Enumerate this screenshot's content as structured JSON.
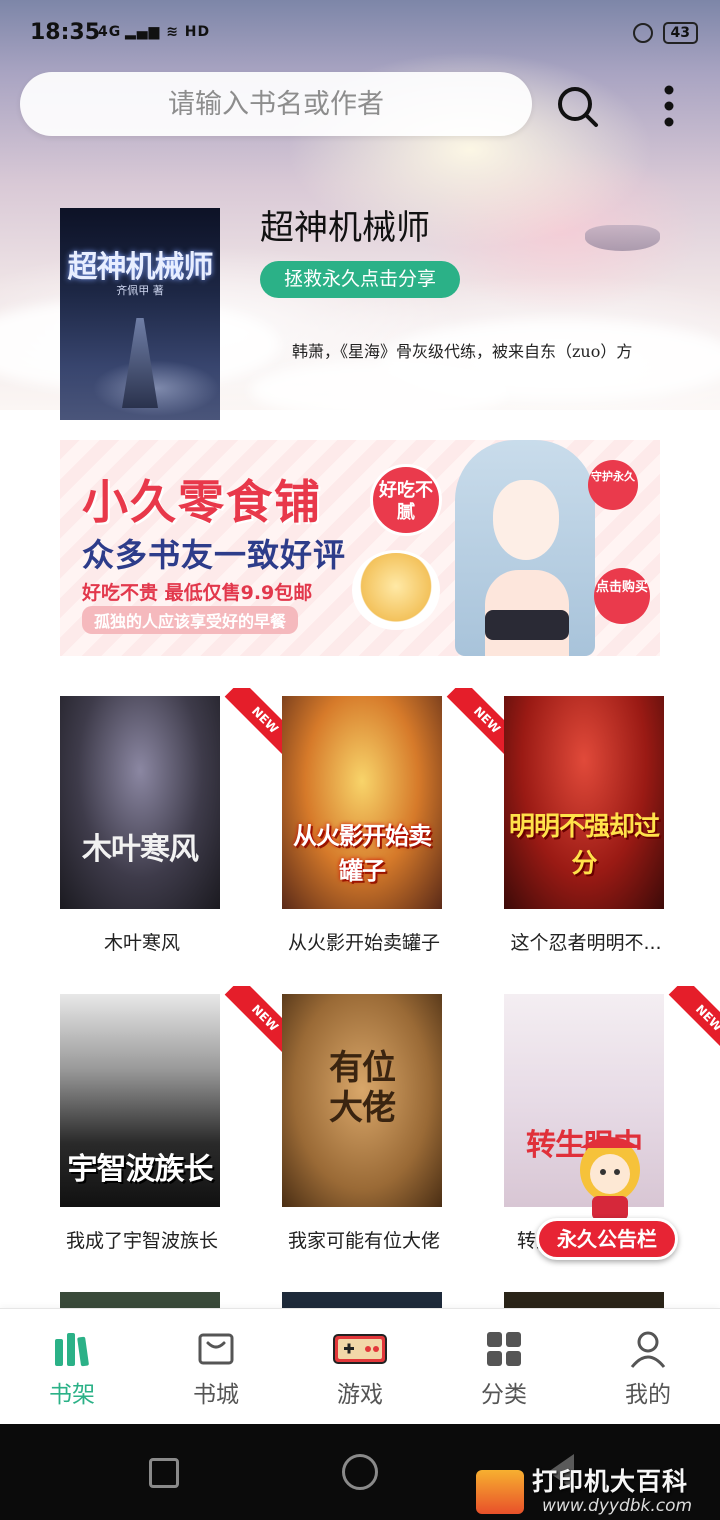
{
  "status_bar": {
    "time": "18:35",
    "indicators": "4G ▂▄▆ ≋ HD",
    "battery": "43"
  },
  "search": {
    "placeholder": "请输入书名或作者"
  },
  "featured": {
    "title": "超神机械师",
    "cover_title": "超神机械师",
    "cover_author": "齐佩甲 著",
    "share_label": "拯救永久点击分享",
    "description": "韩萧，《星海》骨灰级代练，被来自东（zuo）方"
  },
  "banner": {
    "title": "小久零食铺",
    "subtitle": "众多书友一致好评",
    "price": "好吃不贵 最低仅售9.9包邮",
    "tagline": "孤独的人应该享受好的早餐",
    "badge_tasty": "好吃不腻",
    "badge_guard": "守护永久",
    "badge_buy": "点击购买"
  },
  "books": [
    {
      "name": "木叶寒风",
      "cover_text": "木叶寒风",
      "badge": "NEW"
    },
    {
      "name": "从火影开始卖罐子",
      "cover_text": "从火影开始卖罐子",
      "badge": "NEW"
    },
    {
      "name": "这个忍者明明不...",
      "cover_text": "明明不强却过分",
      "badge": "NEW"
    },
    {
      "name": "我成了宇智波族长",
      "cover_text": "宇智波族长",
      "badge": "NEW"
    },
    {
      "name": "我家可能有位大佬",
      "cover_text": "有位大佬",
      "badge": ""
    },
    {
      "name": "转生",
      "cover_text": "转生眼中",
      "badge": "NEW"
    }
  ],
  "notice": {
    "label": "永久公告栏"
  },
  "tabs": [
    {
      "label": "书架",
      "icon": "bookshelf-icon",
      "active": true
    },
    {
      "label": "书城",
      "icon": "bookstore-icon",
      "active": false
    },
    {
      "label": "游戏",
      "icon": "gamepad-icon",
      "active": false
    },
    {
      "label": "分类",
      "icon": "category-icon",
      "active": false
    },
    {
      "label": "我的",
      "icon": "profile-icon",
      "active": false
    }
  ],
  "watermark": {
    "text": "打印机大百科",
    "url": "www.dyydbk.com"
  },
  "colors": {
    "accent": "#2bb187",
    "badge_red": "#e51e2a",
    "notice_red": "#e72434"
  }
}
